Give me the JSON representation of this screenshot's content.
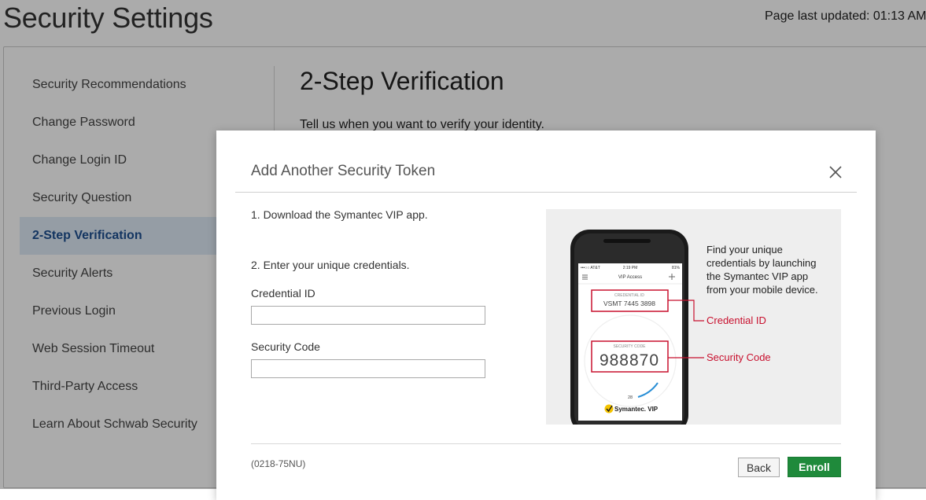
{
  "page": {
    "title": "Security Settings",
    "last_updated": "Page last updated: 01:13 AM"
  },
  "sidebar": {
    "items": [
      {
        "label": "Security Recommendations",
        "active": false
      },
      {
        "label": "Change Password",
        "active": false
      },
      {
        "label": "Change Login ID",
        "active": false
      },
      {
        "label": "Security Question",
        "active": false
      },
      {
        "label": "2-Step Verification",
        "active": true
      },
      {
        "label": "Security Alerts",
        "active": false
      },
      {
        "label": "Previous Login",
        "active": false
      },
      {
        "label": "Web Session Timeout",
        "active": false
      },
      {
        "label": "Third-Party Access",
        "active": false
      },
      {
        "label": "Learn About Schwab Security",
        "active": false
      }
    ]
  },
  "main": {
    "title": "2-Step Verification",
    "subtitle": "Tell us when you want to verify your identity."
  },
  "modal": {
    "title": "Add Another Security Token",
    "step1": "1. Download the Symantec VIP app.",
    "step2": "2. Enter your unique credentials.",
    "credential_label": "Credential ID",
    "credential_value": "",
    "security_code_label": "Security Code",
    "security_code_value": "",
    "illustration": {
      "description_lines": [
        "Find your unique",
        "credentials by launching",
        "the Symantec VIP app",
        "from your mobile device."
      ],
      "credential_callout": "Credential ID",
      "security_code_callout": "Security Code",
      "phone_status_carrier": "•••○○ AT&T",
      "phone_status_time": "2:19 PM",
      "phone_status_battery": "81%",
      "phone_app_title": "VIP Access",
      "phone_credential_caption": "CREDENTIAL ID",
      "phone_credential_value": "VSMT 7445 3898",
      "phone_code_caption": "SECURITY CODE",
      "phone_code_value": "988870",
      "phone_timer": "28",
      "phone_brand": "Symantec. VIP"
    },
    "footer_code": "(0218-75NU)",
    "back_label": "Back",
    "enroll_label": "Enroll"
  },
  "colors": {
    "accent_red": "#c8102e",
    "enroll_green": "#1f8a3b",
    "active_nav_bg": "#dfeaf7",
    "active_nav_text": "#1d4f91"
  },
  "icons": {
    "close": "close-icon",
    "menu": "hamburger-menu-icon",
    "add": "plus-icon",
    "symantec": "symantec-checkmark-logo"
  }
}
